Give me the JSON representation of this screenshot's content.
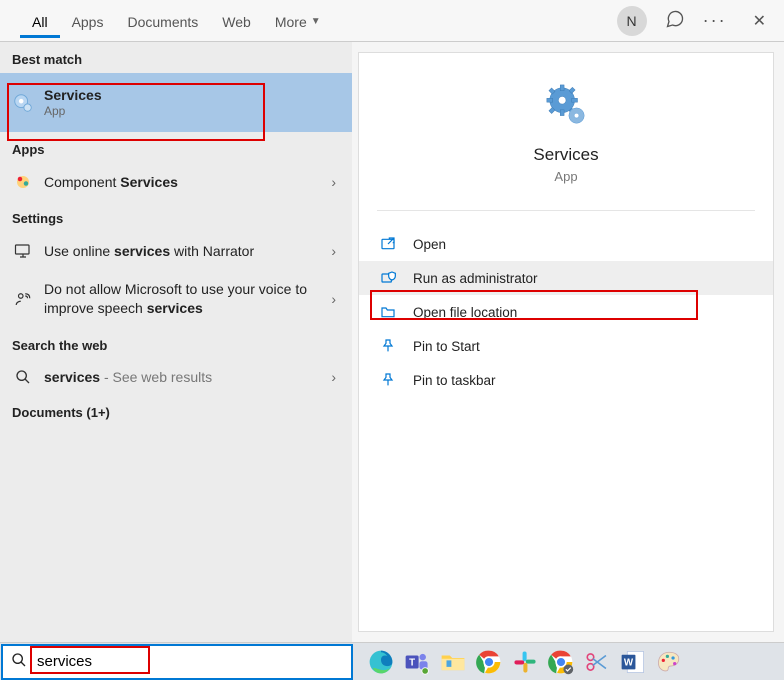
{
  "tabs": {
    "all": "All",
    "apps": "Apps",
    "documents": "Documents",
    "web": "Web",
    "more": "More"
  },
  "user_initial": "N",
  "left": {
    "best_match": "Best match",
    "services_title": "Services",
    "services_sub": "App",
    "apps_header": "Apps",
    "component_pre": "Component ",
    "component_bold": "Services",
    "settings_header": "Settings",
    "narrator_pre": "Use online ",
    "narrator_bold": "services",
    "narrator_post": " with Narrator",
    "msft_pre": "Do not allow Microsoft to use your voice to improve speech ",
    "msft_bold": "services",
    "web_header": "Search the web",
    "web_pre": "",
    "web_bold": "services",
    "web_post": " - See web results",
    "docs_header": "Documents (1+)"
  },
  "preview": {
    "title": "Services",
    "sub": "App",
    "open": "Open",
    "run_admin": "Run as administrator",
    "open_loc": "Open file location",
    "pin_start": "Pin to Start",
    "pin_taskbar": "Pin to taskbar"
  },
  "search_value": "services"
}
